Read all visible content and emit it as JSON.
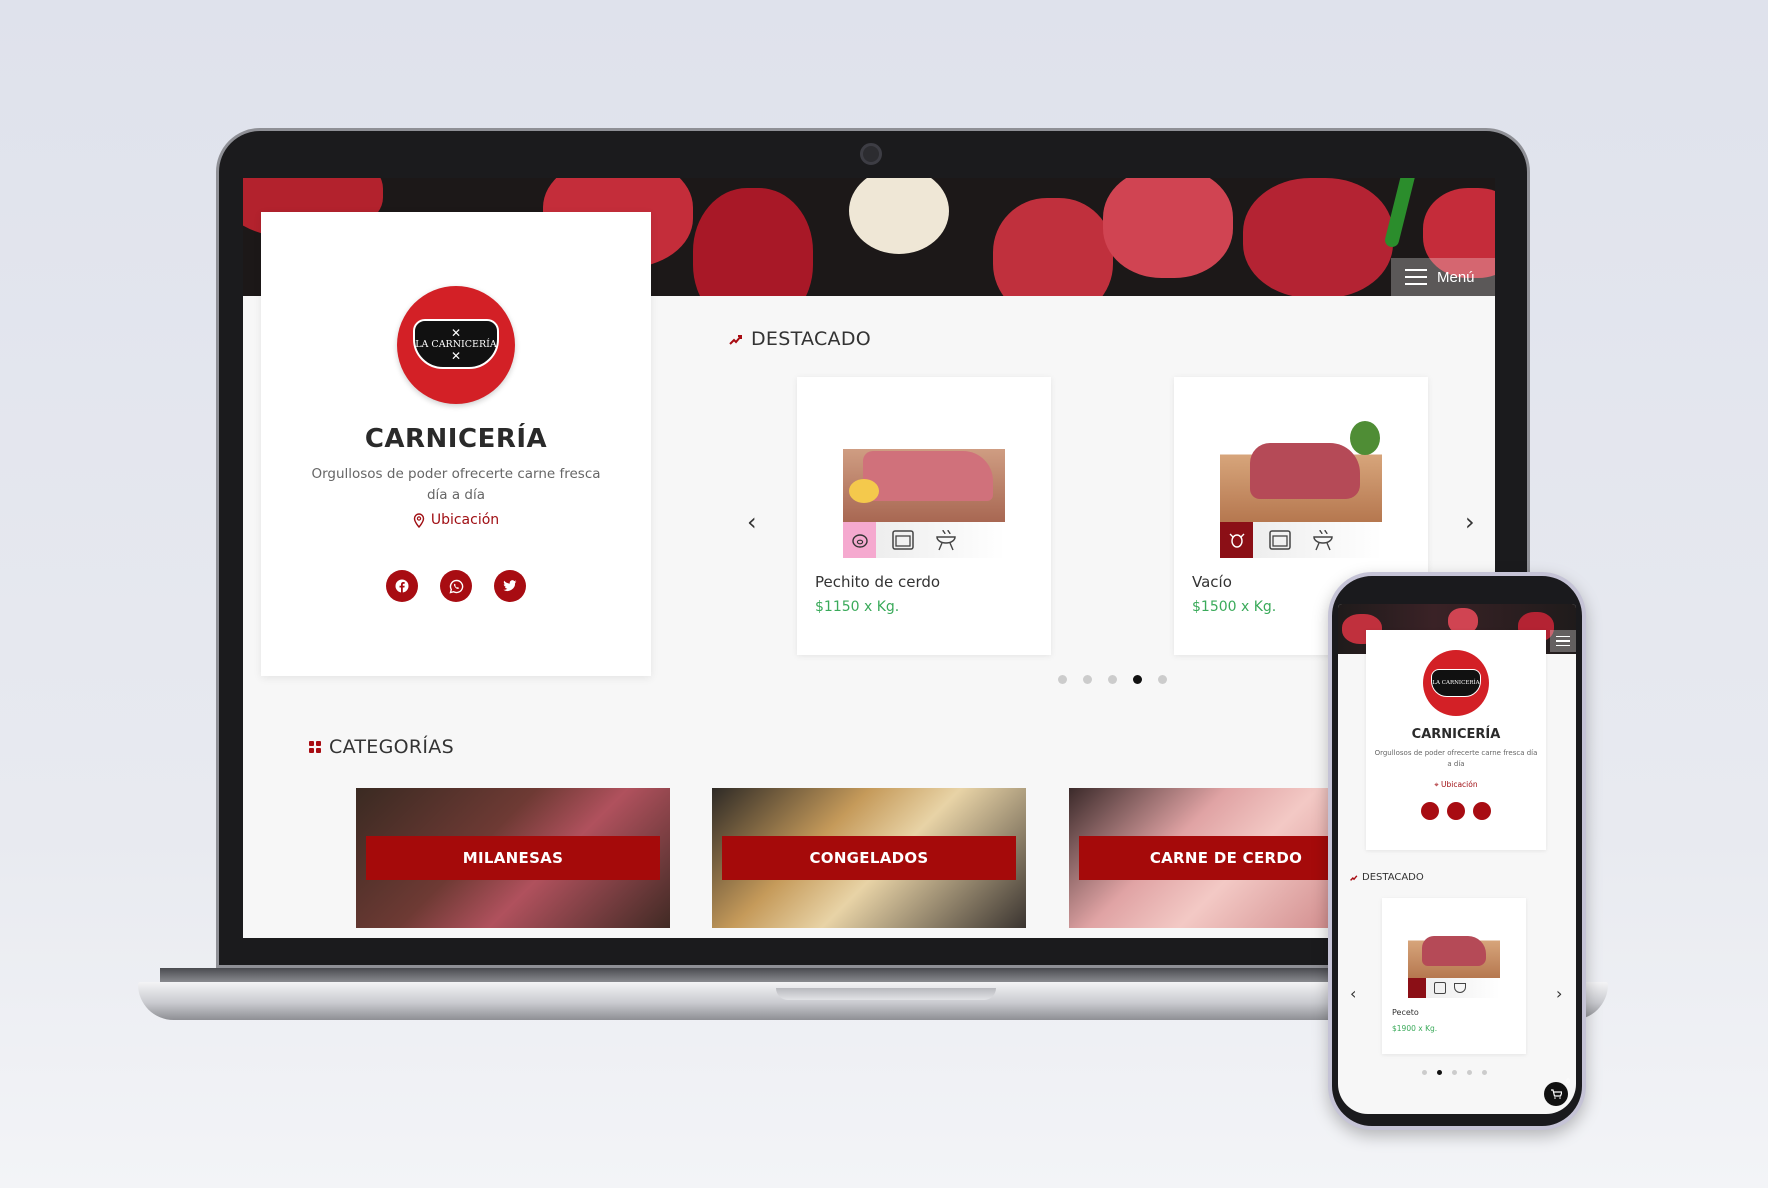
{
  "site": {
    "brand": "CARNICERÍA",
    "logo_text_line1": "LA CARNICERÍA",
    "slogan": "Orgullosos de poder ofrecerte carne fresca día a día",
    "location_label": "Ubicación",
    "menu_label": "Menú"
  },
  "icons": {
    "location": "map-pin-icon",
    "facebook": "facebook-icon",
    "whatsapp": "whatsapp-icon",
    "twitter": "twitter-icon",
    "featured": "trend-arrow-icon",
    "categories": "grid-icon",
    "cart": "cart-icon"
  },
  "featured": {
    "title": "DESTACADO",
    "products": [
      {
        "name": "Pechito de cerdo",
        "price": "$1150 x Kg.",
        "animal_icon": "pig-icon",
        "animal_color": "#f5a9cf"
      },
      {
        "name": "Vacío",
        "price": "$1500 x Kg.",
        "animal_icon": "cow-icon",
        "animal_color": "#8b0f16"
      }
    ],
    "dots": 5,
    "active_dot": 4
  },
  "categories": {
    "title": "CATEGORÍAS",
    "items": [
      {
        "label": "MILANESAS"
      },
      {
        "label": "CONGELADOS"
      },
      {
        "label": "CARNE DE CERDO"
      }
    ]
  },
  "mobile": {
    "brand": "CARNICERÍA",
    "slogan": "Orgullosos de poder ofrecerte carne fresca día a día",
    "location_label": "Ubicación",
    "featured_title": "DESTACADO",
    "product": {
      "name": "Peceto",
      "price": "$1900 x Kg."
    },
    "active_dot": 2,
    "cart_count": "0"
  },
  "colors": {
    "accent": "#a80c12",
    "logo_red": "#d32026",
    "price_green": "#3aaa5a"
  }
}
